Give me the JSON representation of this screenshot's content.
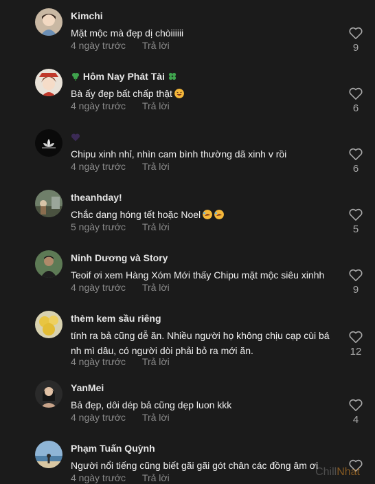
{
  "comments": [
    {
      "username": "Kimchi",
      "text": "Mặt mộc mà đẹp dị chòiiiiii",
      "time": "4 ngày trước",
      "reply": "Trả lời",
      "likes": "9",
      "avatar_icon": "cartoon-girl-avatar"
    },
    {
      "username": "Hôm Nay Phát Tài",
      "username_prefix_icon": "shamrock-icon",
      "username_suffix_icon": "four-leaf-clover-icon",
      "text": "Bà ấy đẹp bất chấp thật",
      "text_emoji": "laughing-face-emoji",
      "time": "4 ngày trước",
      "reply": "Trả lời",
      "likes": "6",
      "avatar_icon": "anime-girl-avatar"
    },
    {
      "username": "",
      "username_icon": "purple-heart-icon",
      "text": "Chipu xinh nhỉ, nhìn cam bình thường dã xinh v rồi",
      "time": "4 ngày trước",
      "reply": "Trả lời",
      "likes": "6",
      "avatar_icon": "lotus-avatar"
    },
    {
      "username": "theanhday!",
      "text": "Chắc dang hóng tết hoặc Noel",
      "text_emoji": "rolling-laughing-emoji-x2",
      "time": "5 ngày trước",
      "reply": "Trả lời",
      "likes": "5",
      "avatar_icon": "outdoor-photo-avatar"
    },
    {
      "username": "Ninh Dương và Story",
      "text": "Teoif ơi xem Hàng Xóm Mới thấy Chipu mặt mộc siêu xinhh",
      "time": "4 ngày trước",
      "reply": "Trả lời",
      "likes": "9",
      "avatar_icon": "man-photo-avatar"
    },
    {
      "username": "thèm kem sầu riêng",
      "text": "tính ra bả cũng dễ ăn. Nhiều người họ không chịu cạp cùi bá nh mì dâu, có người dòi phải bỏ ra mới ăn.",
      "time": "4 ngày trước",
      "reply": "Trả lời",
      "likes": "12",
      "avatar_icon": "durian-avatar"
    },
    {
      "username": "YanMei",
      "text": "Bả đẹp, dôi dép bả cũng dẹp luon kkk",
      "time": "4 ngày trước",
      "reply": "Trả lời",
      "likes": "4",
      "avatar_icon": "woman-photo-avatar"
    },
    {
      "username": "Phạm Tuấn Quỳnh",
      "text": "Người nổi tiếng cũng biết gãi gãi gót chân các đồng âm ơi",
      "time": "4 ngày trước",
      "reply": "Trả lời",
      "likes": "",
      "avatar_icon": "beach-photo-avatar"
    }
  ],
  "watermark": {
    "part1": "Chill",
    "part2": "Nhat"
  },
  "colors": {
    "background": "#1b1b1b",
    "username": "#e6e6e6",
    "text": "#f1f1f1",
    "meta": "#8a8a8a",
    "heart_outline": "#a8a8a8"
  }
}
